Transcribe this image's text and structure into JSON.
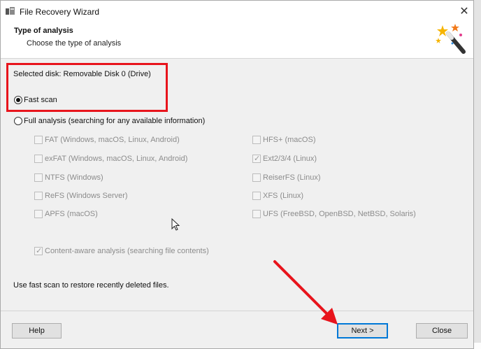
{
  "window": {
    "title": "File Recovery Wizard",
    "close_label": "✕"
  },
  "header": {
    "title": "Type of analysis",
    "subtitle": "Choose the type of analysis"
  },
  "selected_disk": "Selected disk: Removable Disk 0 (Drive)",
  "scan_options": [
    {
      "label": "Fast scan",
      "checked": true
    },
    {
      "label": "Full analysis (searching for any available information)",
      "checked": false
    }
  ],
  "filesystems_left": [
    {
      "label": "FAT (Windows, macOS, Linux, Android)",
      "checked": false
    },
    {
      "label": "exFAT (Windows, macOS, Linux, Android)",
      "checked": false
    },
    {
      "label": "NTFS (Windows)",
      "checked": false
    },
    {
      "label": "ReFS (Windows Server)",
      "checked": false
    },
    {
      "label": "APFS (macOS)",
      "checked": false
    }
  ],
  "filesystems_right": [
    {
      "label": "HFS+ (macOS)",
      "checked": false
    },
    {
      "label": "Ext2/3/4 (Linux)",
      "checked": true
    },
    {
      "label": "ReiserFS (Linux)",
      "checked": false
    },
    {
      "label": "XFS (Linux)",
      "checked": false
    },
    {
      "label": "UFS (FreeBSD, OpenBSD, NetBSD, Solaris)",
      "checked": false
    }
  ],
  "content_aware": {
    "label": "Content-aware analysis (searching file contents)",
    "checked": true
  },
  "hint": "Use fast scan to restore recently deleted files.",
  "buttons": {
    "help": "Help",
    "next": "Next >",
    "close": "Close"
  },
  "colors": {
    "highlight_box": "#e8141c",
    "annotation_arrow": "#e8141c",
    "primary_border": "#0078d7"
  }
}
